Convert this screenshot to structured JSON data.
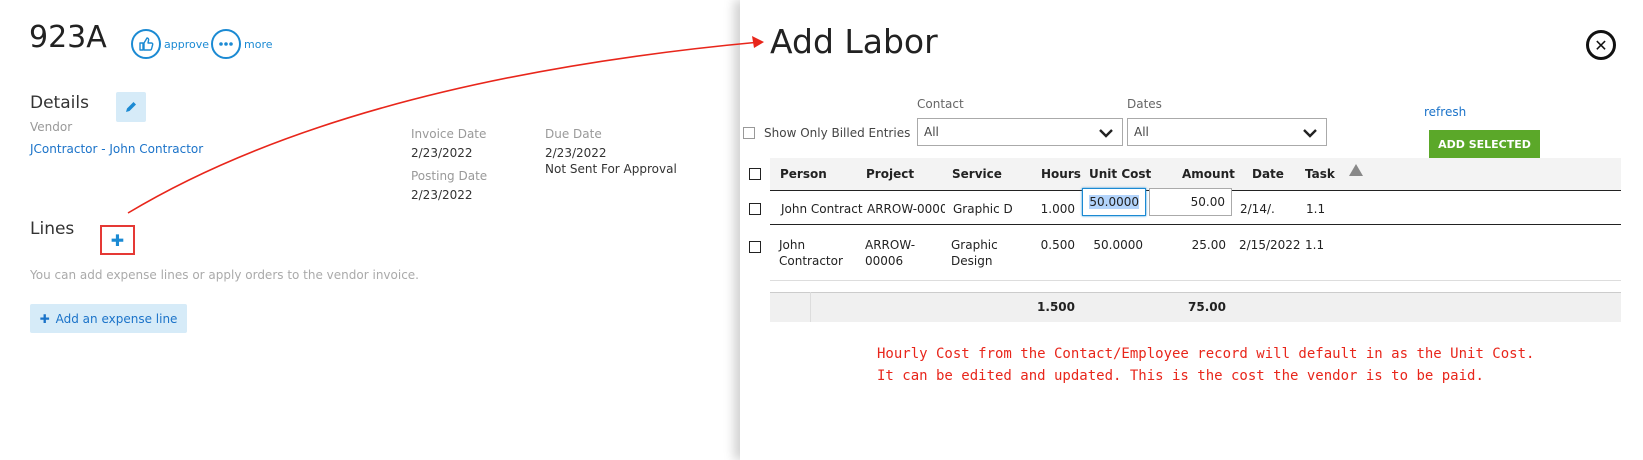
{
  "invoice": {
    "number": "923A",
    "approve_label": "approve",
    "more_label": "more",
    "details_heading": "Details",
    "vendor_label": "Vendor",
    "vendor_value": "JContractor - John Contractor",
    "invoice_date_label": "Invoice Date",
    "invoice_date_value": "2/23/2022",
    "posting_date_label": "Posting Date",
    "posting_date_value": "2/23/2022",
    "due_date_label": "Due Date",
    "due_date_value": "2/23/2022",
    "approval_status": "Not Sent For Approval",
    "lines_heading": "Lines",
    "lines_hint": "You can add expense lines or apply orders to the vendor invoice.",
    "add_expense_label": "Add an expense line"
  },
  "modal": {
    "title": "Add Labor",
    "show_billed_label": "Show Only Billed Entries",
    "contact_label": "Contact",
    "contact_value": "All",
    "dates_label": "Dates",
    "dates_value": "All",
    "refresh_label": "refresh",
    "add_selected_label": "ADD SELECTED",
    "columns": {
      "person": "Person",
      "project": "Project",
      "service": "Service",
      "hours": "Hours",
      "unit_cost": "Unit Cost",
      "amount": "Amount",
      "date": "Date",
      "task": "Task"
    },
    "rows": [
      {
        "person": "John Contract",
        "project": "ARROW-0000(",
        "service": "Graphic D",
        "hours": "1.000",
        "unit_cost": "50.0000",
        "amount": "50.00",
        "date": "2/14/.",
        "task": "1.1"
      },
      {
        "person_l1": "John",
        "person_l2": "Contractor",
        "project_l1": "ARROW-",
        "project_l2": "00006",
        "service_l1": "Graphic",
        "service_l2": "Design",
        "hours": "0.500",
        "unit_cost": "50.0000",
        "amount": "25.00",
        "date": "2/15/2022",
        "task": "1.1"
      }
    ],
    "totals": {
      "hours": "1.500",
      "amount": "75.00"
    },
    "annotation": [
      "Hourly Cost from the Contact/Employee record will default in as the Unit Cost.",
      "It can be edited and updated. This is the cost the vendor is to be paid."
    ]
  },
  "colors": {
    "accent_blue": "#1b8ad3",
    "add_green": "#5ba829",
    "annotation_red": "#e8261b"
  }
}
